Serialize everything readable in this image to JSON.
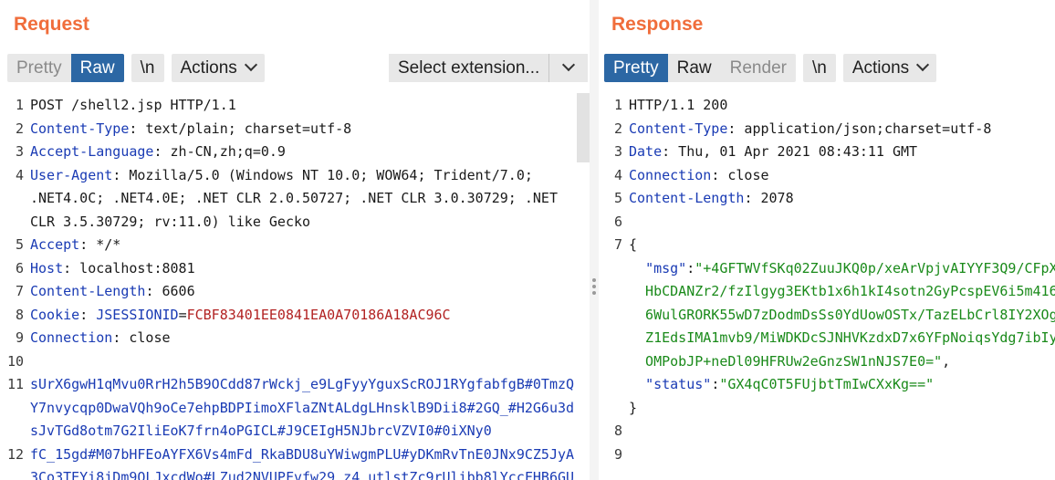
{
  "request": {
    "title": "Request",
    "toolbar": {
      "pretty": "Pretty",
      "raw": "Raw",
      "newline": "\\n",
      "actions": "Actions",
      "select_extension": "Select extension..."
    },
    "lines": [
      {
        "num": "1",
        "segments": [
          {
            "t": "POST /shell2.jsp HTTP/1.1",
            "c": "plain"
          }
        ]
      },
      {
        "num": "2",
        "segments": [
          {
            "t": "Content-Type",
            "c": "hk"
          },
          {
            "t": ": text/plain; charset=utf-8",
            "c": "plain"
          }
        ]
      },
      {
        "num": "3",
        "segments": [
          {
            "t": "Accept-Language",
            "c": "hk"
          },
          {
            "t": ": zh-CN,zh;q=0.9",
            "c": "plain"
          }
        ]
      },
      {
        "num": "4",
        "segments": [
          {
            "t": "User-Agent",
            "c": "hk"
          },
          {
            "t": ": Mozilla/5.0 (Windows NT 10.0; WOW64; Trident/7.0;",
            "c": "plain"
          }
        ]
      },
      {
        "num": "",
        "segments": [
          {
            "t": ".NET4.0C; .NET4.0E; .NET CLR 2.0.50727; .NET CLR 3.0.30729; .NET",
            "c": "plain"
          }
        ]
      },
      {
        "num": "",
        "segments": [
          {
            "t": "CLR 3.5.30729; rv:11.0) like Gecko",
            "c": "plain"
          }
        ]
      },
      {
        "num": "5",
        "segments": [
          {
            "t": "Accept",
            "c": "hk"
          },
          {
            "t": ": */*",
            "c": "plain"
          }
        ]
      },
      {
        "num": "6",
        "segments": [
          {
            "t": "Host",
            "c": "hk"
          },
          {
            "t": ": localhost:8081",
            "c": "plain"
          }
        ]
      },
      {
        "num": "7",
        "segments": [
          {
            "t": "Content-Length",
            "c": "hk"
          },
          {
            "t": ": 6606",
            "c": "plain"
          }
        ]
      },
      {
        "num": "8",
        "segments": [
          {
            "t": "Cookie",
            "c": "hk"
          },
          {
            "t": ": ",
            "c": "plain"
          },
          {
            "t": "JSESSIONID",
            "c": "ck"
          },
          {
            "t": "=",
            "c": "plain"
          },
          {
            "t": "FCBF83401EE0841EA0A70186A18AC96C",
            "c": "cv"
          }
        ]
      },
      {
        "num": "9",
        "segments": [
          {
            "t": "Connection",
            "c": "hk"
          },
          {
            "t": ": close",
            "c": "plain"
          }
        ]
      },
      {
        "num": "10",
        "segments": []
      },
      {
        "num": "11",
        "segments": [
          {
            "t": "sUrX6gwH1qMvu0RrH2h5B9OCdd87rWckj_e9LgFyyYguxScROJ1RYgfabfgB#0TmzQ",
            "c": "bl"
          }
        ]
      },
      {
        "num": "",
        "segments": [
          {
            "t": "Y7nvycqp0DwaVQh9oCe7ehpBDPIimoXFlaZNtALdgLHnsklB9Dii8#2GQ_#H2G6u3d",
            "c": "bl"
          }
        ]
      },
      {
        "num": "",
        "segments": [
          {
            "t": "sJvTGd8otm7G2IliEoK7frn4oPGICL#J9CEIgH5NJbrcVZVI0#0iXNy0",
            "c": "bl"
          }
        ]
      },
      {
        "num": "12",
        "segments": [
          {
            "t": "fC_15gd#M07bHFEoAYFX6Vs4mFd_RkaBDU8uYWiwgmPLU#yDKmRvTnE0JNx9CZ5JyA",
            "c": "bl"
          }
        ]
      },
      {
        "num": "",
        "segments": [
          {
            "t": "3Co3TEYi8jDm9OLJxcdWo#LZud2NVUPFvfw29_z4_utlstZc9rUlibb8lYccFHB6GU",
            "c": "bl"
          }
        ]
      }
    ]
  },
  "response": {
    "title": "Response",
    "toolbar": {
      "pretty": "Pretty",
      "raw": "Raw",
      "render": "Render",
      "newline": "\\n",
      "actions": "Actions"
    },
    "lines": [
      {
        "num": "1",
        "segments": [
          {
            "t": "HTTP/1.1 200",
            "c": "plain"
          }
        ]
      },
      {
        "num": "2",
        "segments": [
          {
            "t": "Content-Type",
            "c": "hk"
          },
          {
            "t": ": application/json;charset=utf-8",
            "c": "plain"
          }
        ]
      },
      {
        "num": "3",
        "segments": [
          {
            "t": "Date",
            "c": "hk"
          },
          {
            "t": ": Thu, 01 Apr 2021 08:43:11 GMT",
            "c": "plain"
          }
        ]
      },
      {
        "num": "4",
        "segments": [
          {
            "t": "Connection",
            "c": "hk"
          },
          {
            "t": ": close",
            "c": "plain"
          }
        ]
      },
      {
        "num": "5",
        "segments": [
          {
            "t": "Content-Length",
            "c": "hk"
          },
          {
            "t": ": 2078",
            "c": "plain"
          }
        ]
      },
      {
        "num": "6",
        "segments": []
      },
      {
        "num": "7",
        "segments": [
          {
            "t": "{",
            "c": "plain"
          }
        ]
      },
      {
        "num": "",
        "segments": [
          {
            "t": "  ",
            "c": "plain"
          },
          {
            "t": "\"msg\"",
            "c": "jk"
          },
          {
            "t": ":",
            "c": "plain"
          },
          {
            "t": "\"+4GFTWVfSKq02ZuuJKQ0p/xeArVpjvAIYYF3Q9/CFpX",
            "c": "js"
          }
        ]
      },
      {
        "num": "",
        "segments": [
          {
            "t": "  HbCDANZr2/fzIlgyg3EKtb1x6h1kI4sotn2GyPcspEV6i5m416",
            "c": "js"
          }
        ]
      },
      {
        "num": "",
        "segments": [
          {
            "t": "  6WulGRORK55wD7zDodmDsSs0YdUowOSTx/TazELbCrl8IY2XOg",
            "c": "js"
          }
        ]
      },
      {
        "num": "",
        "segments": [
          {
            "t": "  Z1EdsIMA1mvb9/MiWDKDcSJNHVKzdxD7x6YFpNoiqsYdg7ibIy",
            "c": "js"
          }
        ]
      },
      {
        "num": "",
        "segments": [
          {
            "t": "  OMPobJP+neDl09HFRUw2eGnzSW1nNJS7E0=\"",
            "c": "js"
          },
          {
            "t": ",",
            "c": "plain"
          }
        ]
      },
      {
        "num": "",
        "segments": [
          {
            "t": "  ",
            "c": "plain"
          },
          {
            "t": "\"status\"",
            "c": "jk"
          },
          {
            "t": ":",
            "c": "plain"
          },
          {
            "t": "\"GX4qC0T5FUjbtTmIwCXxKg==\"",
            "c": "js"
          }
        ]
      },
      {
        "num": "",
        "segments": [
          {
            "t": "}",
            "c": "plain"
          }
        ]
      },
      {
        "num": "8",
        "segments": []
      },
      {
        "num": "9",
        "segments": []
      }
    ]
  },
  "colors": {
    "title": "#f06d3b",
    "active_button": "#2c67a4",
    "header_key": "#1a3bb4",
    "cookie_value": "#b22222",
    "json_string": "#1a8a1a"
  }
}
